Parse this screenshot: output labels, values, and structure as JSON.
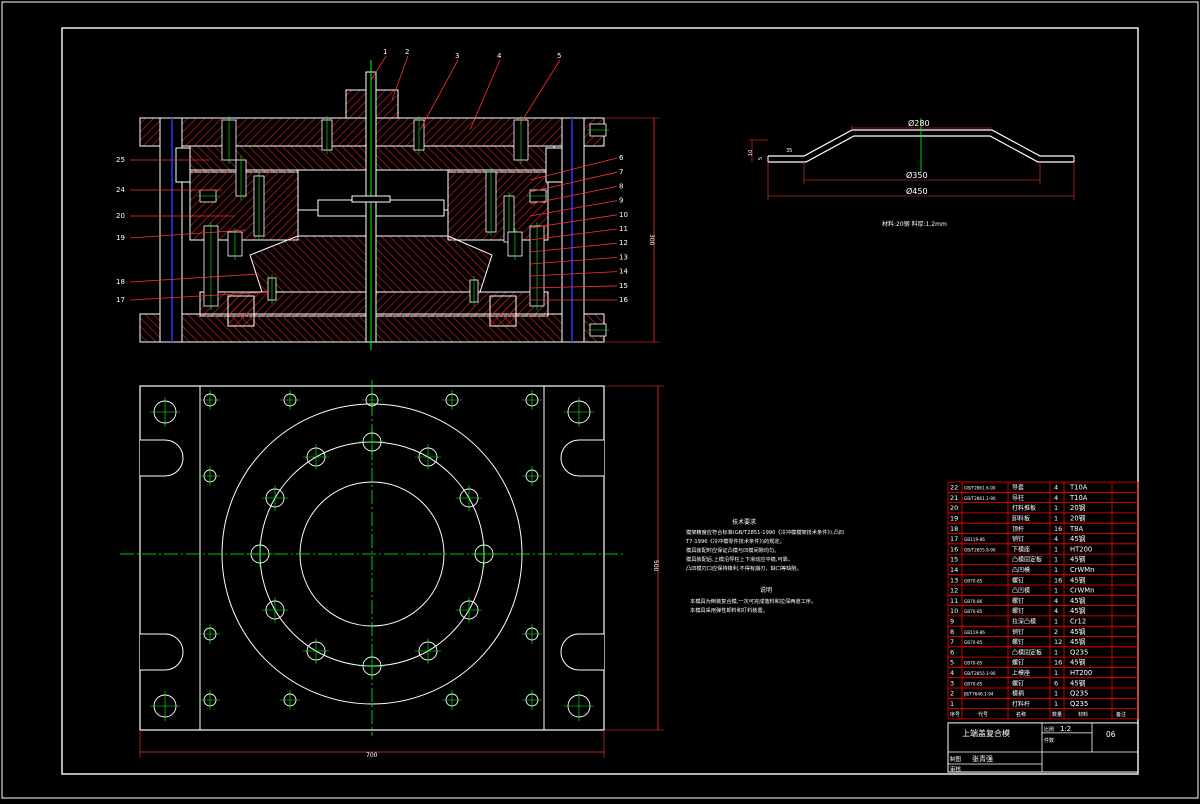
{
  "colors": {
    "background": "#000000",
    "outline": "#ffffff",
    "frame_red": "#ff0000",
    "center_line": "#00ff00",
    "hatch": "#c02020",
    "dimension": "#ff3030",
    "blue": "#3030ff",
    "yellow": "#ffff00"
  },
  "callouts_top": [
    "1",
    "2",
    "3",
    "4",
    "5"
  ],
  "callouts_right": [
    "6",
    "7",
    "8",
    "9",
    "10",
    "11",
    "12",
    "13",
    "14",
    "15",
    "16"
  ],
  "callouts_left": [
    "25",
    "24",
    "20",
    "19",
    "18",
    "17"
  ],
  "height_dimension": "300",
  "plan_height_dimension": "500",
  "plan_width_dimension": "700",
  "part_dims": {
    "top_dia": "Ø280",
    "mid_dia": "Ø350",
    "base_dia": "Ø450",
    "left_small": "10",
    "left_small2": "5",
    "top_small": "35"
  },
  "material_note": "材料:20钢  料厚:1.2mm",
  "tech_title": "技术要求",
  "tech_lines": [
    "模架精度应符合标准(GB/T2851-1990《冷冲模模架技术条件》),凸凹",
    "T7-1996《冷冲模零件技术条件》)的规定。",
    "模具装配时应保证凸模与凹模间隙均匀。",
    "模具装配后,上模沿导柱上下滑动应平稳,可靠。",
    "凸凹模刃口应保持锋利,不得有崩刃、缺口等缺陷。"
  ],
  "notes_title": "说明",
  "notes_lines": [
    "本模具为倒装复合模,一次可完成落料和拉深两道工序。",
    "本模具采用弹性卸料和打料装置。"
  ],
  "bom_rows": [
    {
      "no": "22",
      "code": "GB/T2861.6-90",
      "name": "导套",
      "qty": "4",
      "mat": "T10A"
    },
    {
      "no": "21",
      "code": "GB/T2861.1-90",
      "name": "导柱",
      "qty": "4",
      "mat": "T10A"
    },
    {
      "no": "20",
      "code": "",
      "name": "打料推板",
      "qty": "1",
      "mat": "20钢"
    },
    {
      "no": "19",
      "code": "",
      "name": "卸料板",
      "qty": "1",
      "mat": "20钢"
    },
    {
      "no": "18",
      "code": "",
      "name": "顶杆",
      "qty": "16",
      "mat": "T8A"
    },
    {
      "no": "17",
      "code": "GB119-86",
      "name": "销钉",
      "qty": "4",
      "mat": "45钢"
    },
    {
      "no": "16",
      "code": "GB/T2855.8-90",
      "name": "下模座",
      "qty": "1",
      "mat": "HT200"
    },
    {
      "no": "15",
      "code": "",
      "name": "凸模固定板",
      "qty": "1",
      "mat": "45钢"
    },
    {
      "no": "14",
      "code": "",
      "name": "凸凹模",
      "qty": "1",
      "mat": "CrWMn"
    },
    {
      "no": "13",
      "code": "GB70-85",
      "name": "螺钉",
      "qty": "16",
      "mat": "45钢"
    },
    {
      "no": "12",
      "code": "",
      "name": "凸凹模",
      "qty": "1",
      "mat": "CrWMn"
    },
    {
      "no": "11",
      "code": "GB70-86",
      "name": "螺钉",
      "qty": "4",
      "mat": "45钢"
    },
    {
      "no": "10",
      "code": "GB70-85",
      "name": "螺钉",
      "qty": "4",
      "mat": "45钢"
    },
    {
      "no": "9",
      "code": "",
      "name": "拉深凸模",
      "qty": "1",
      "mat": "Cr12"
    },
    {
      "no": "8",
      "code": "GB119-86",
      "name": "销钉",
      "qty": "2",
      "mat": "45钢"
    },
    {
      "no": "7",
      "code": "GB70-85",
      "name": "螺钉",
      "qty": "12",
      "mat": "45钢"
    },
    {
      "no": "6",
      "code": "",
      "name": "凸模固定板",
      "qty": "1",
      "mat": "Q235"
    },
    {
      "no": "5",
      "code": "GB70-85",
      "name": "螺钉",
      "qty": "16",
      "mat": "45钢"
    },
    {
      "no": "4",
      "code": "GB/T2855.1-90",
      "name": "上模座",
      "qty": "1",
      "mat": "HT200"
    },
    {
      "no": "3",
      "code": "GB70-85",
      "name": "螺钉",
      "qty": "6",
      "mat": "45钢"
    },
    {
      "no": "2",
      "code": "JB/T7646.1-94",
      "name": "模柄",
      "qty": "1",
      "mat": "Q235"
    },
    {
      "no": "1",
      "code": "",
      "name": "打料杆",
      "qty": "1",
      "mat": "Q235"
    }
  ],
  "bom_header": {
    "no": "序号",
    "code": "代号",
    "name": "名称",
    "qty": "数量",
    "mat": "材料",
    "remark": "备注"
  },
  "title_block": {
    "drawing_name": "上端盖复合模",
    "scale_label": "比例",
    "scale": "1:2",
    "sheet_label": "件数",
    "sheet": "06",
    "designer_label": "制图",
    "designer": "张青强",
    "checker_label": "审核"
  }
}
